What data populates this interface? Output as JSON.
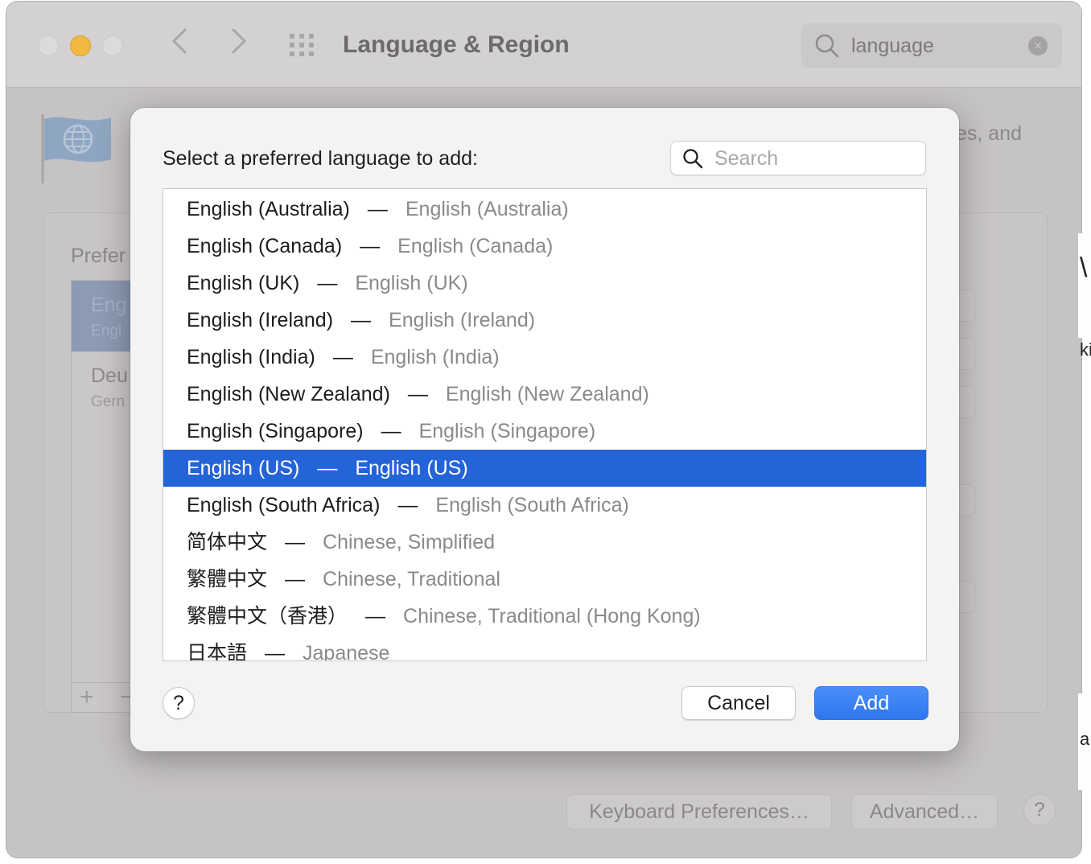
{
  "window": {
    "title": "Language & Region",
    "search_value": "language",
    "description_fragment": "es, and",
    "preferred_label": "Prefer",
    "languages": [
      {
        "name": "Eng",
        "sub": "Engl"
      },
      {
        "name": "Deu",
        "sub": "Gern"
      }
    ],
    "plus_label": "+",
    "minus_label": "−",
    "keyboard_prefs_label": "Keyboard Preferences…",
    "advanced_label": "Advanced…",
    "help_label": "?",
    "edge_fragments": {
      "top": "\\",
      "middle": "ki",
      "bottom": "a"
    }
  },
  "dialog": {
    "prompt": "Select a preferred language to add:",
    "search_placeholder": "Search",
    "separator": "—",
    "selected_index": 7,
    "languages": [
      {
        "native": "English (Australia)",
        "english": "English (Australia)"
      },
      {
        "native": "English (Canada)",
        "english": "English (Canada)"
      },
      {
        "native": "English (UK)",
        "english": "English (UK)"
      },
      {
        "native": "English (Ireland)",
        "english": "English (Ireland)"
      },
      {
        "native": "English (India)",
        "english": "English (India)"
      },
      {
        "native": "English (New Zealand)",
        "english": "English (New Zealand)"
      },
      {
        "native": "English (Singapore)",
        "english": "English (Singapore)"
      },
      {
        "native": "English (US)",
        "english": "English (US)"
      },
      {
        "native": "English (South Africa)",
        "english": "English (South Africa)"
      },
      {
        "native": "简体中文",
        "english": "Chinese, Simplified"
      },
      {
        "native": "繁體中文",
        "english": "Chinese, Traditional"
      },
      {
        "native": "繁體中文（香港）",
        "english": "Chinese, Traditional (Hong Kong)"
      },
      {
        "native": "日本語",
        "english": "Japanese"
      }
    ],
    "help_label": "?",
    "cancel_label": "Cancel",
    "add_label": "Add"
  },
  "colors": {
    "selection": "#2464d9",
    "add_button": "#3b82f6",
    "minimize_light": "#f2b942"
  }
}
